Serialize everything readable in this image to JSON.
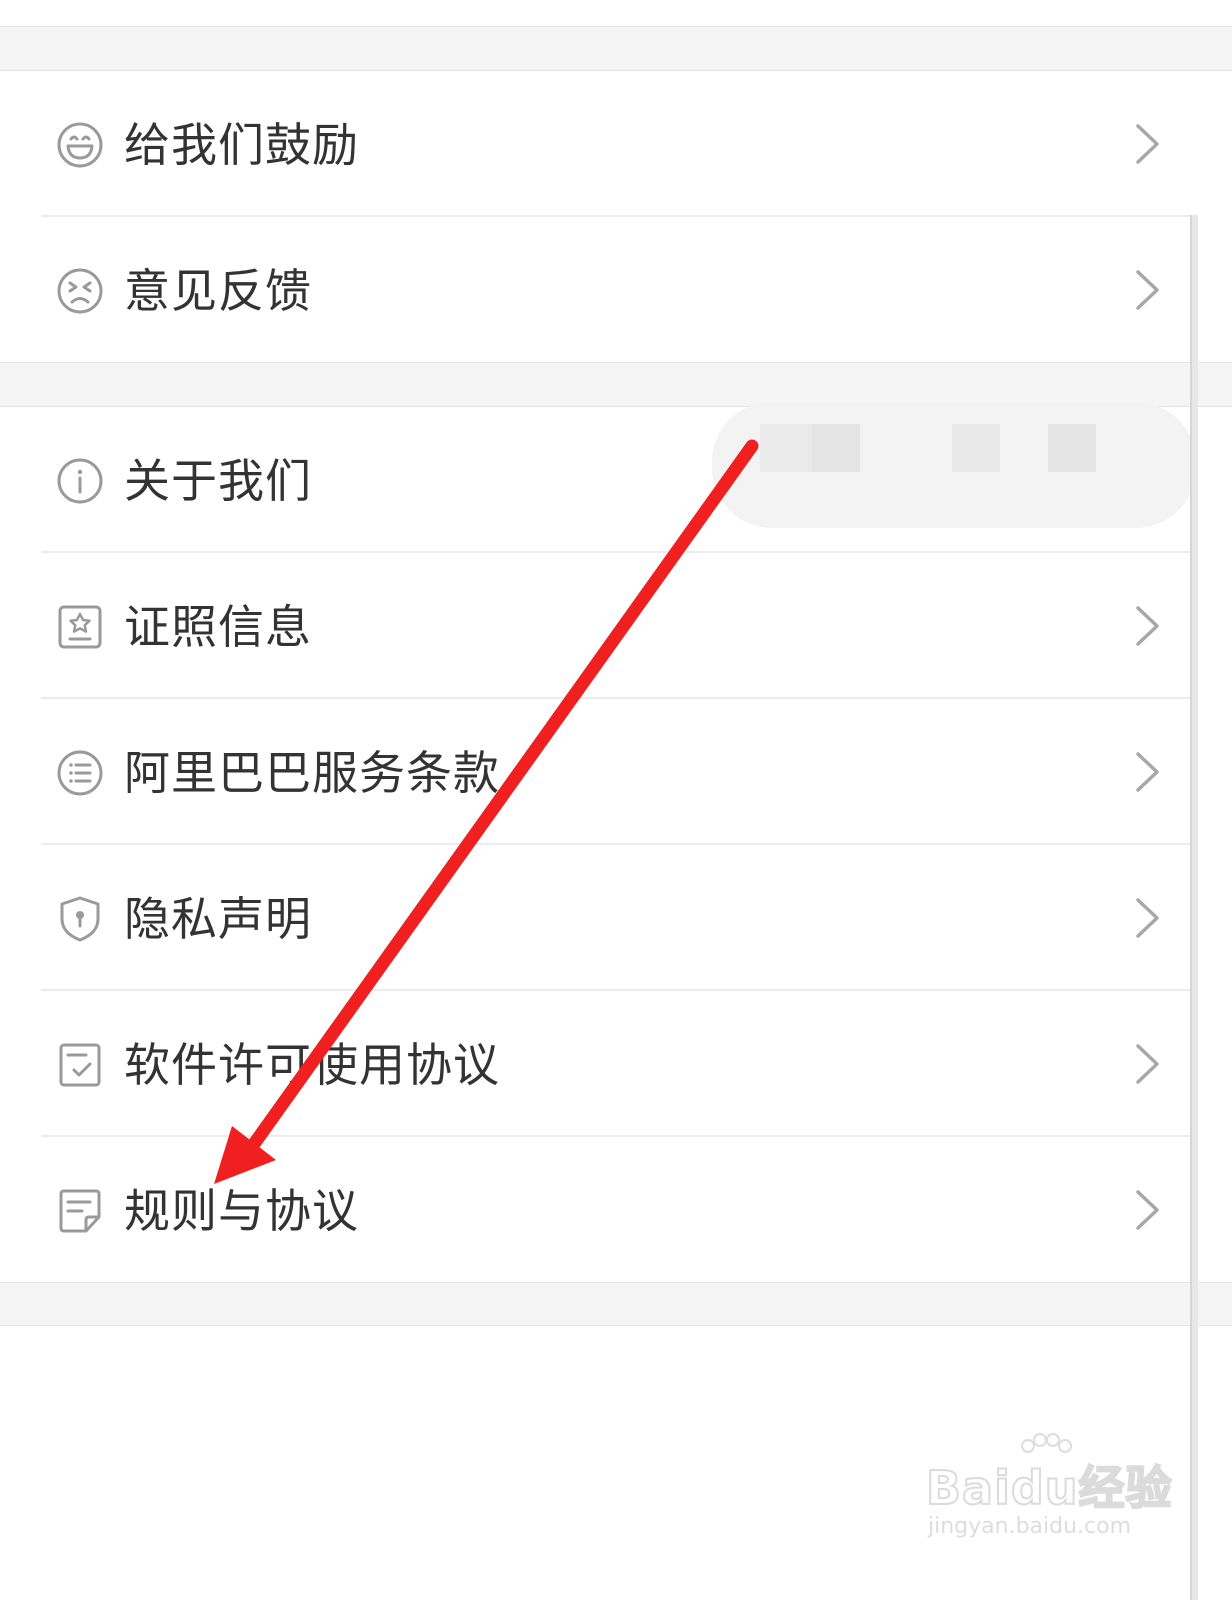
{
  "menu": {
    "group1": [
      {
        "label": "给我们鼓励",
        "icon": "smile-face-icon"
      },
      {
        "label": "意见反馈",
        "icon": "sad-face-icon"
      }
    ],
    "group2": [
      {
        "label": "关于我们",
        "icon": "info-circle-icon"
      },
      {
        "label": "证照信息",
        "icon": "license-star-icon"
      },
      {
        "label": "阿里巴巴服务条款",
        "icon": "list-circle-icon"
      },
      {
        "label": "隐私声明",
        "icon": "shield-lock-icon"
      },
      {
        "label": "软件许可使用协议",
        "icon": "checked-document-icon"
      },
      {
        "label": "规则与协议",
        "icon": "note-document-icon"
      }
    ]
  },
  "annotation": {
    "arrow_color": "#f02020"
  },
  "watermark": {
    "logo": "Baidu经验",
    "url": "jingyan.baidu.com"
  },
  "colors": {
    "text": "#333333",
    "icon": "#9a9a9a",
    "chevron": "#a8a8a8",
    "divider": "#ececec",
    "gap_background": "#f5f5f5"
  }
}
